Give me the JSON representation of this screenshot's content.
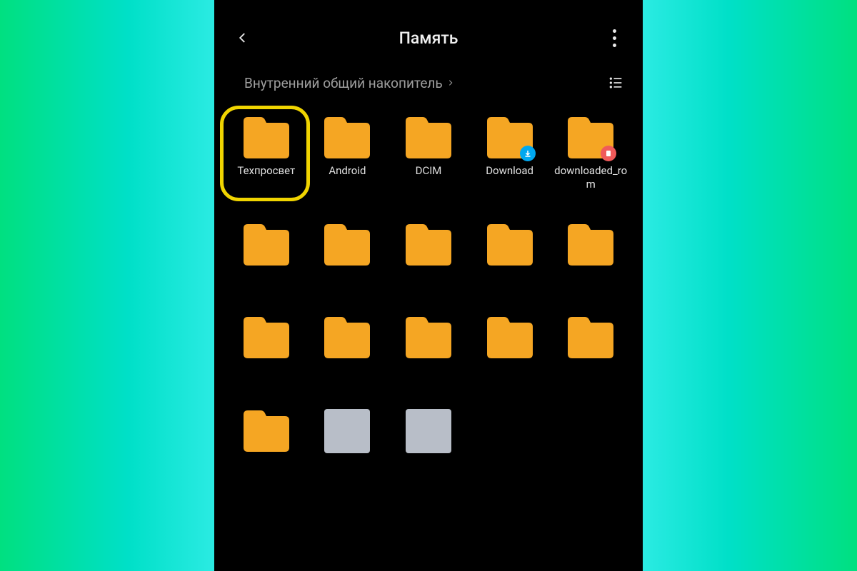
{
  "header": {
    "title": "Память"
  },
  "breadcrumb": {
    "label": "Внутренний общий накопитель"
  },
  "folders": [
    {
      "label": "Техпросвет",
      "highlighted": true
    },
    {
      "label": "Android"
    },
    {
      "label": "DCIM"
    },
    {
      "label": "Download",
      "badge": "download"
    },
    {
      "label": "downloaded_rom",
      "badge": "sd"
    }
  ],
  "colors": {
    "folder": "#f5a623",
    "highlight": "#f0d400",
    "download_badge": "#00a8f0",
    "sd_badge": "#f05a5a"
  }
}
